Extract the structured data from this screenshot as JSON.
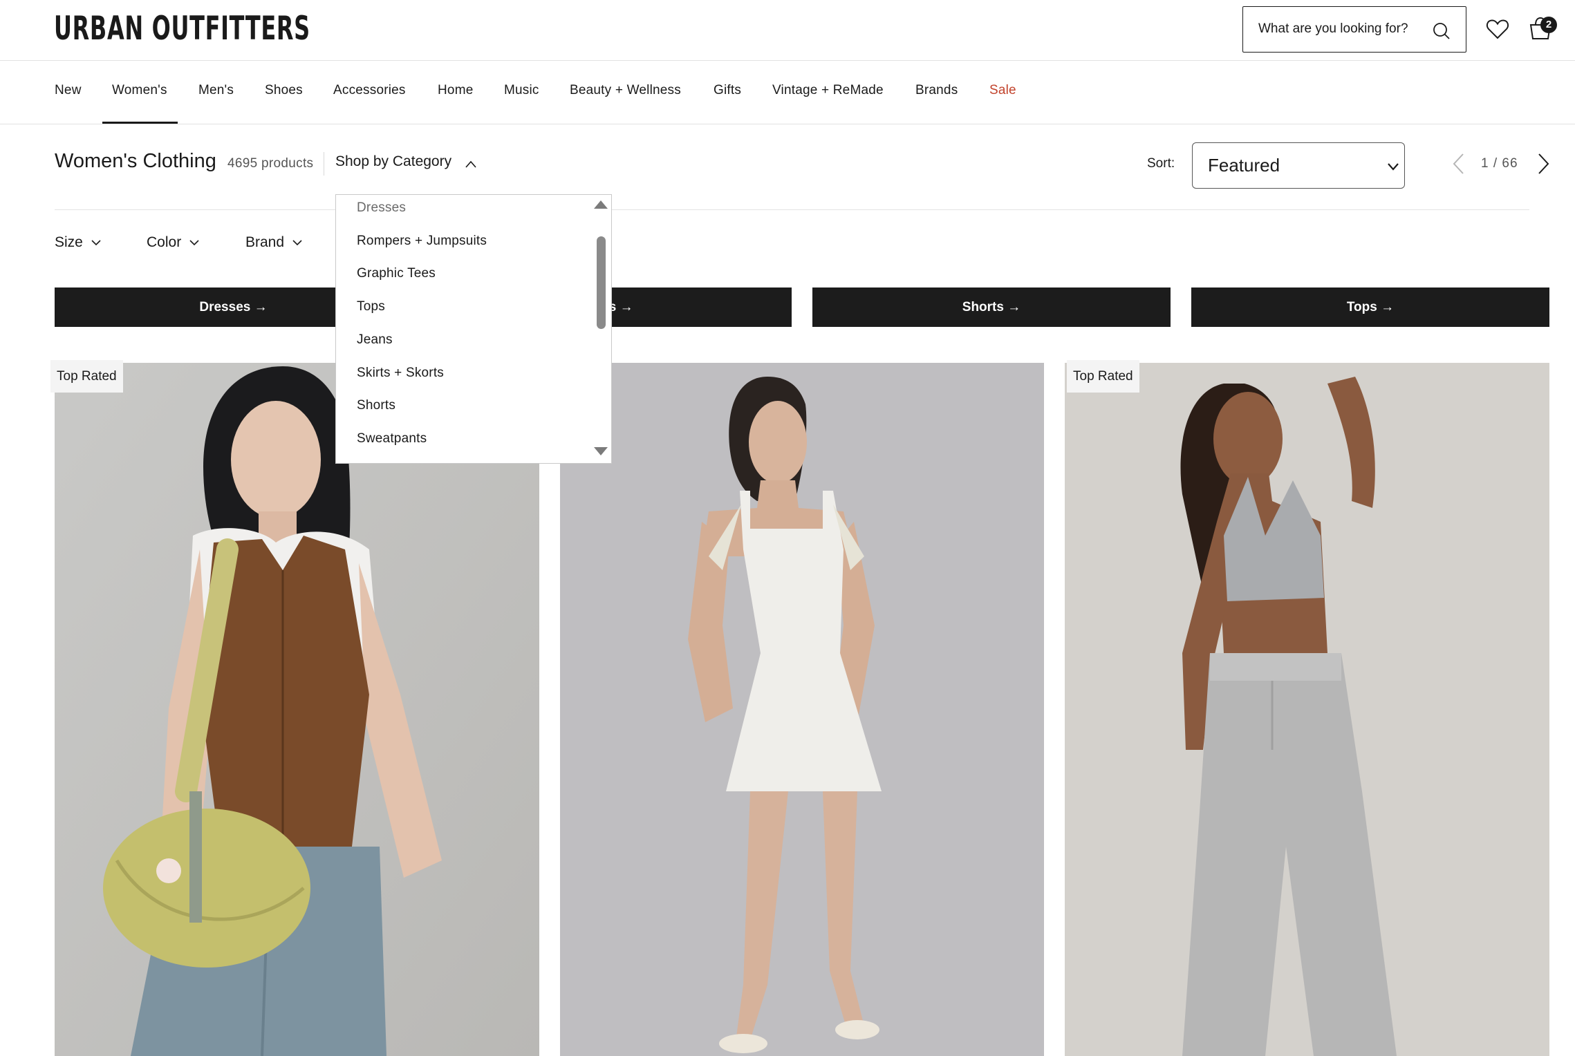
{
  "header": {
    "logo": "URBAN OUTFITTERS",
    "search_placeholder": "What are you looking for?",
    "cart_count": "2"
  },
  "nav": {
    "items": [
      {
        "label": "New"
      },
      {
        "label": "Women's"
      },
      {
        "label": "Men's"
      },
      {
        "label": "Shoes"
      },
      {
        "label": "Accessories"
      },
      {
        "label": "Home"
      },
      {
        "label": "Music"
      },
      {
        "label": "Beauty + Wellness"
      },
      {
        "label": "Gifts"
      },
      {
        "label": "Vintage + ReMade"
      },
      {
        "label": "Brands"
      },
      {
        "label": "Sale"
      }
    ],
    "active": "Women's",
    "sale_color": "#c2432c"
  },
  "listing": {
    "title": "Women's Clothing",
    "count": "4695 products",
    "shop_by_category": "Shop by Category",
    "sort_label": "Sort:",
    "sort_value": "Featured",
    "page_current": "1",
    "page_sep": "/",
    "page_total": "66"
  },
  "filters": [
    {
      "label": "Size"
    },
    {
      "label": "Color"
    },
    {
      "label": "Brand"
    }
  ],
  "category_bars": [
    {
      "label": "Dresses →"
    },
    {
      "label": "Tees →"
    },
    {
      "label": "Shorts →"
    },
    {
      "label": "Tops →"
    }
  ],
  "category_dropdown": {
    "items": [
      {
        "label": "Dresses"
      },
      {
        "label": "Rompers + Jumpsuits"
      },
      {
        "label": "Graphic Tees"
      },
      {
        "label": "Tops"
      },
      {
        "label": "Jeans"
      },
      {
        "label": "Skirts + Skorts"
      },
      {
        "label": "Shorts"
      },
      {
        "label": "Sweatpants"
      }
    ]
  },
  "products": [
    {
      "badge": "Top Rated",
      "image": "model-in-suede-vest-with-yellow-bag"
    },
    {
      "badge": "",
      "image": "model-in-white-mini-dress"
    },
    {
      "badge": "Top Rated",
      "image": "model-in-grey-halter-and-sweatpants"
    }
  ]
}
